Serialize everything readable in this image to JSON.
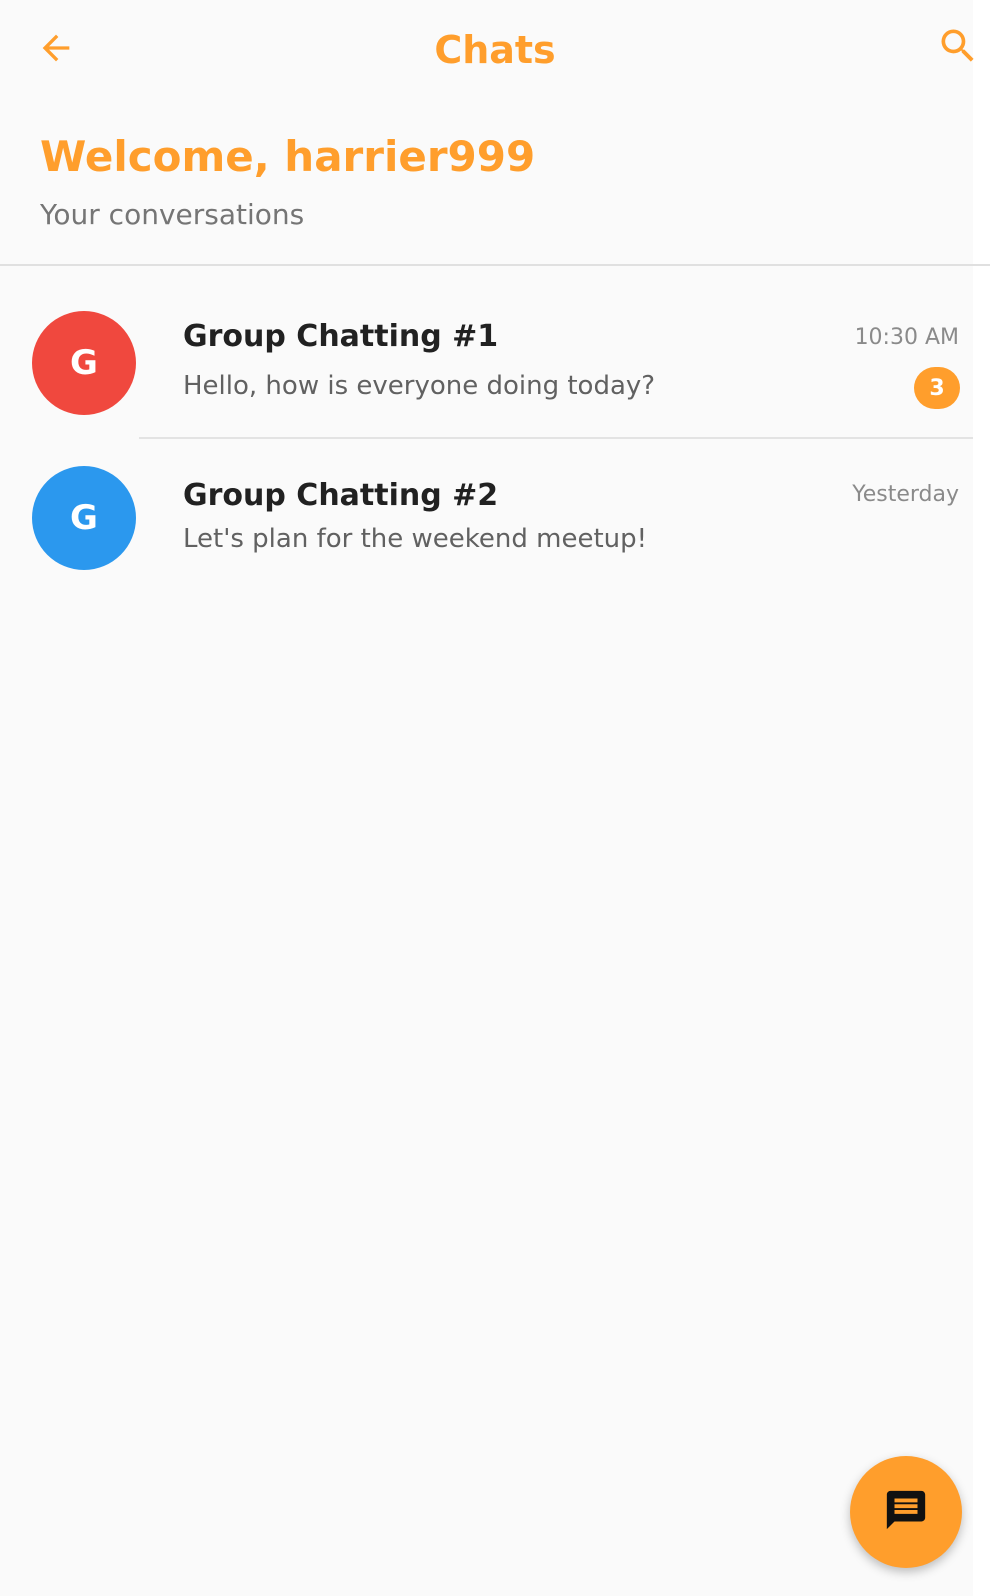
{
  "colors": {
    "accent": "#ff9e2c",
    "background": "#fafafa",
    "avatar_red": "#f0483e",
    "avatar_blue": "#2b98ee",
    "text_primary": "#212121",
    "text_secondary": "#616161"
  },
  "appbar": {
    "title": "Chats",
    "back_icon": "arrow-back-icon",
    "search_icon": "search-icon"
  },
  "header": {
    "welcome": "Welcome, harrier999",
    "subtitle": "Your conversations"
  },
  "chats": [
    {
      "avatar_letter": "G",
      "avatar_color": "#f0483e",
      "name": "Group Chatting #1",
      "last_message": "Hello, how is everyone doing today?",
      "time": "10:30 AM",
      "unread": "3"
    },
    {
      "avatar_letter": "G",
      "avatar_color": "#2b98ee",
      "name": "Group Chatting #2",
      "last_message": "Let's plan for the weekend meetup!",
      "time": "Yesterday"
    }
  ],
  "fab": {
    "icon": "chat-icon"
  }
}
